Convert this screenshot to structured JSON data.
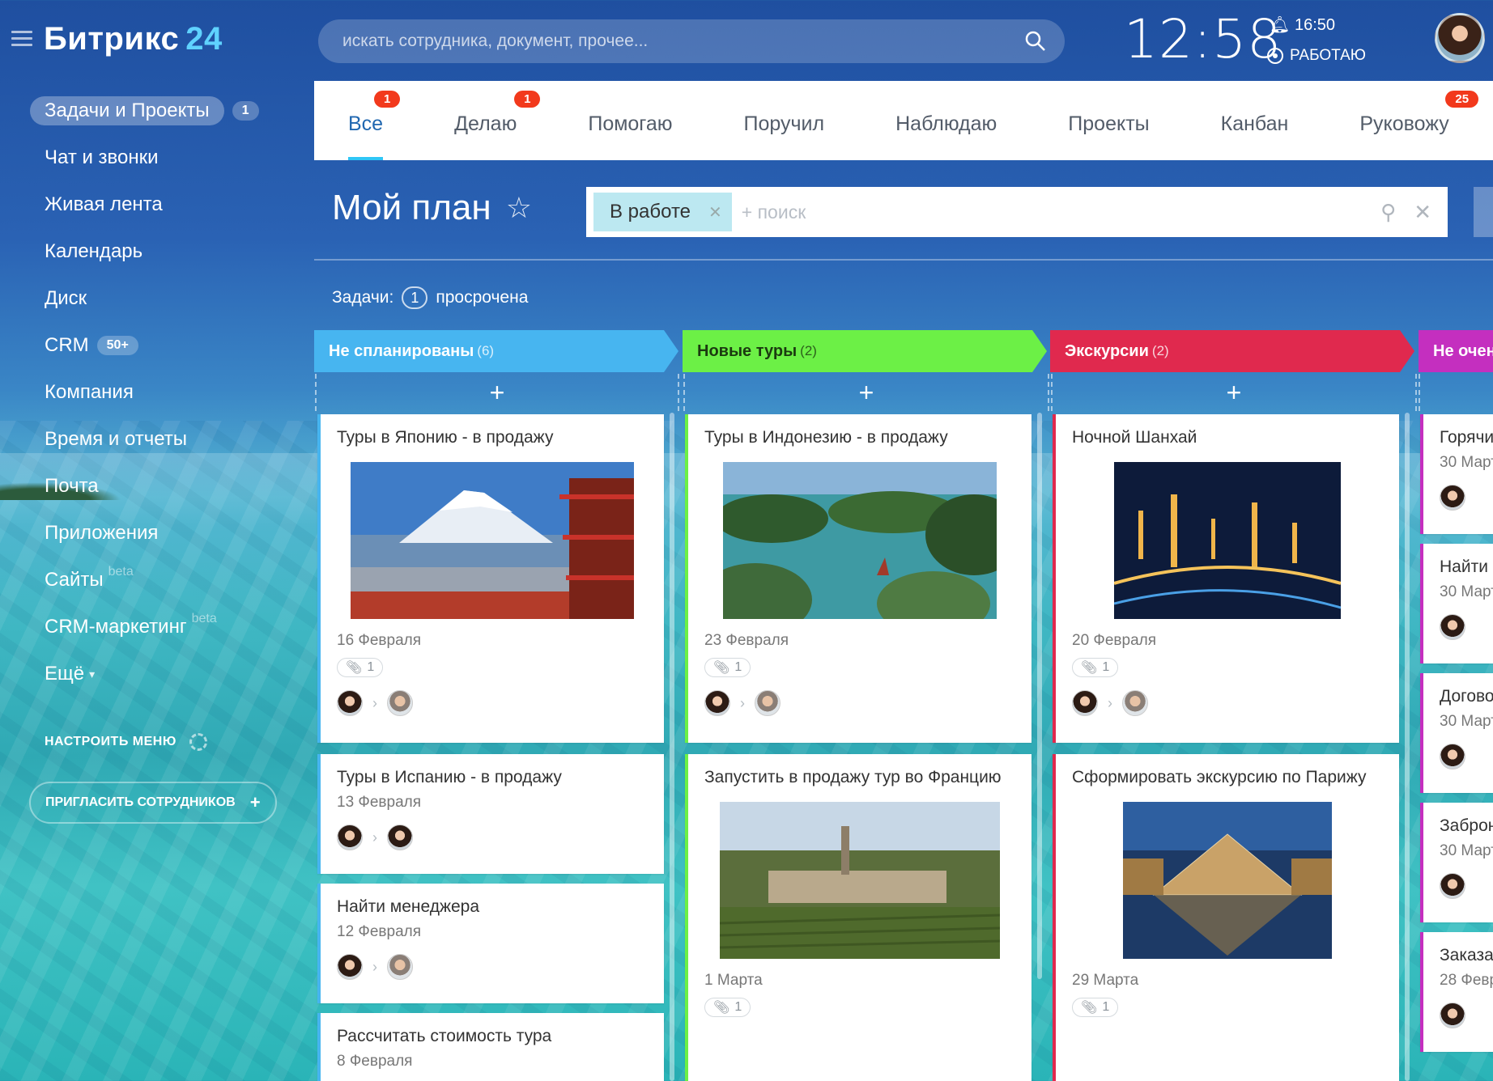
{
  "app": {
    "logo_name": "Битрикс",
    "logo_num": "24"
  },
  "search": {
    "placeholder": "искать сотрудника, документ, прочее..."
  },
  "clock": {
    "time": "12:58",
    "alarm": "16:50",
    "status": "РАБОТАЮ"
  },
  "sidebar": {
    "items": [
      {
        "label": "Задачи и Проекты",
        "badge": "1"
      },
      {
        "label": "Чат и звонки"
      },
      {
        "label": "Живая лента"
      },
      {
        "label": "Календарь"
      },
      {
        "label": "Диск"
      },
      {
        "label": "CRM",
        "badge": "50+"
      },
      {
        "label": "Компания"
      },
      {
        "label": "Время и отчеты"
      },
      {
        "label": "Почта"
      },
      {
        "label": "Приложения"
      },
      {
        "label": "Сайты",
        "sup": "beta"
      },
      {
        "label": "CRM-маркетинг",
        "sup": "beta"
      },
      {
        "label": "Ещё"
      }
    ],
    "configure": "НАСТРОИТЬ МЕНЮ",
    "invite": "ПРИГЛАСИТЬ СОТРУДНИКОВ"
  },
  "tabs": [
    {
      "label": "Все",
      "count": "1"
    },
    {
      "label": "Делаю",
      "count": "1"
    },
    {
      "label": "Помогаю"
    },
    {
      "label": "Поручил"
    },
    {
      "label": "Наблюдаю"
    },
    {
      "label": "Проекты"
    },
    {
      "label": "Канбан"
    },
    {
      "label": "Руковожу",
      "count": "25"
    }
  ],
  "plan": {
    "title": "Мой план",
    "filter_chip": "В работе",
    "filter_placeholder": "+ поиск"
  },
  "tasks_summary": {
    "label": "Задачи:",
    "count": "1",
    "text": "просрочена"
  },
  "columns": [
    {
      "title": "Не спланированы",
      "count": "(6)",
      "color": "#47b5f0"
    },
    {
      "title": "Новые туры",
      "count": "(2)",
      "color": "#6cf046"
    },
    {
      "title": "Экскурсии",
      "count": "(2)",
      "color": "#e0294e"
    },
    {
      "title": "Не очен",
      "count": "",
      "color": "#c42fbf"
    }
  ],
  "cards": {
    "col1": [
      {
        "title": "Туры в Японию - в продажу",
        "date": "16 Февраля",
        "files": "1"
      },
      {
        "title": "Туры в Испанию - в продажу",
        "date": "13 Февраля"
      },
      {
        "title": "Найти менеджера",
        "date": "12 Февраля"
      },
      {
        "title": "Рассчитать стоимость тура",
        "date": "8 Февраля"
      }
    ],
    "col2": [
      {
        "title": "Туры в Индонезию - в продажу",
        "date": "23 Февраля",
        "files": "1"
      },
      {
        "title": "Запустить в продажу тур во Францию",
        "date": "1 Марта",
        "files": "1"
      }
    ],
    "col3": [
      {
        "title": "Ночной Шанхай",
        "date": "20 Февраля",
        "files": "1"
      },
      {
        "title": "Сформировать экскурсию по Парижу",
        "date": "29 Марта",
        "files": "1"
      }
    ],
    "col4": [
      {
        "title": "Горячи",
        "date": "30 Март"
      },
      {
        "title": "Найти",
        "date": "30 Март"
      },
      {
        "title": "Догово",
        "date": "30 Март"
      },
      {
        "title": "Заброн",
        "date": "30 Март"
      },
      {
        "title": "Заказа",
        "date": "28 Февр"
      }
    ]
  },
  "colors": {
    "accent": "#2fc6f6",
    "badge": "#f2391c",
    "tab_active": "#2067b0"
  }
}
